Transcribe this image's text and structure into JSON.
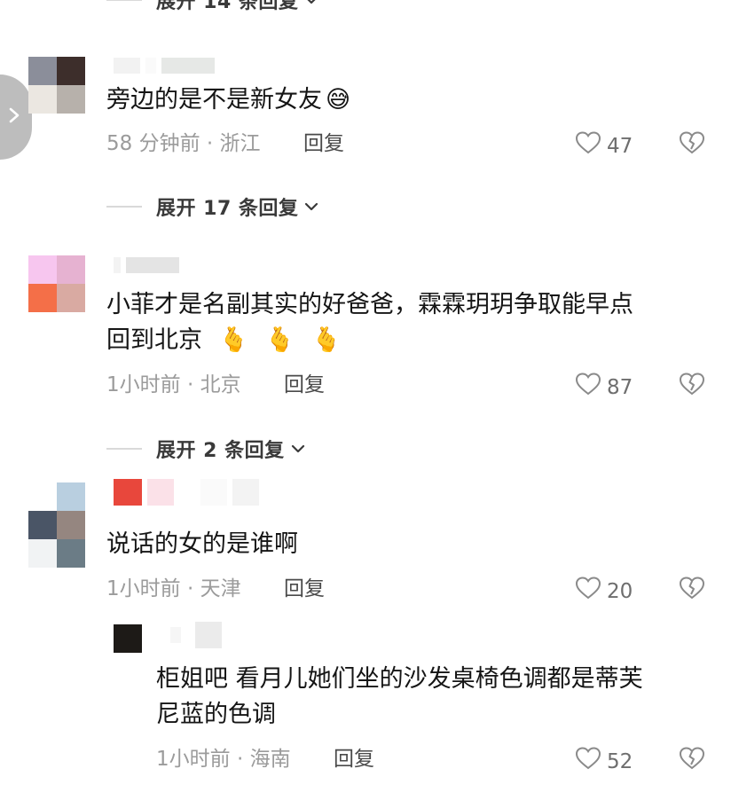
{
  "top_expand": {
    "label": "展开 14 条回复"
  },
  "comments": [
    {
      "text": "旁边的是不是新女友",
      "emoji": "😅",
      "time_location": "58 分钟前 · 浙江",
      "reply_label": "回复",
      "likes": "47",
      "expand_label": "展开 17 条回复"
    },
    {
      "text_line1": "小菲才是名副其实的好爸爸，霖霖玥玥争取能早点",
      "text_line2": "回到北京",
      "emojis": [
        "🫰",
        "🫰",
        "🫰"
      ],
      "time_location": "1小时前 · 北京",
      "reply_label": "回复",
      "likes": "87",
      "expand_label": "展开 2 条回复"
    },
    {
      "text": "说话的女的是谁啊",
      "time_location": "1小时前 · 天津",
      "reply_label": "回复",
      "likes": "20"
    }
  ],
  "reply": {
    "text_line1": "柜姐吧 看月儿她们坐的沙发桌椅色调都是蒂芙",
    "text_line2": "尼蓝的色调",
    "time_location": "1小时前 · 海南",
    "reply_label": "回复",
    "likes": "52"
  },
  "icons": {
    "like": "heart-outline-icon",
    "dislike": "broken-heart-icon",
    "expand": "chevron-down-icon",
    "nav": "chevron-right-icon"
  },
  "colors": {
    "text": "#151515",
    "meta": "#9b9b9b",
    "reply": "#4a4a4a"
  }
}
